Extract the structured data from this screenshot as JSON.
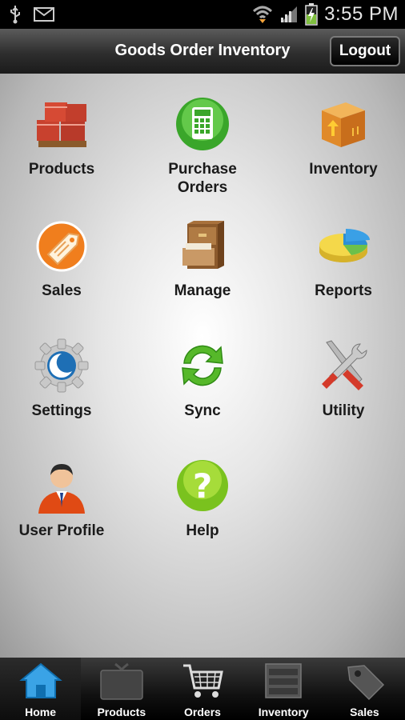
{
  "status_bar": {
    "time": "3:55 PM"
  },
  "header": {
    "title": "Goods Order Inventory",
    "logout_label": "Logout"
  },
  "tiles": [
    {
      "label": "Products",
      "icon": "boxes-pallet-icon"
    },
    {
      "label": "Purchase\nOrders",
      "icon": "calculator-icon"
    },
    {
      "label": "Inventory",
      "icon": "box-up-arrow-icon"
    },
    {
      "label": "Sales",
      "icon": "price-tag-icon"
    },
    {
      "label": "Manage",
      "icon": "file-cabinet-icon"
    },
    {
      "label": "Reports",
      "icon": "pie-chart-icon"
    },
    {
      "label": "Settings",
      "icon": "gear-icon"
    },
    {
      "label": "Sync",
      "icon": "sync-arrows-icon"
    },
    {
      "label": "Utility",
      "icon": "tools-icon"
    },
    {
      "label": "User Profile",
      "icon": "user-icon"
    },
    {
      "label": "Help",
      "icon": "help-icon"
    }
  ],
  "tabbar": {
    "items": [
      {
        "label": "Home",
        "icon": "home-icon",
        "active": true
      },
      {
        "label": "Products",
        "icon": "gift-box-icon"
      },
      {
        "label": "Orders",
        "icon": "cart-icon"
      },
      {
        "label": "Inventory",
        "icon": "drawer-icon"
      },
      {
        "label": "Sales",
        "icon": "tag-icon"
      }
    ]
  },
  "colors": {
    "accent": "#3aa3e6",
    "header_bg": "#2e2e2e",
    "tab_bg": "#111111"
  }
}
